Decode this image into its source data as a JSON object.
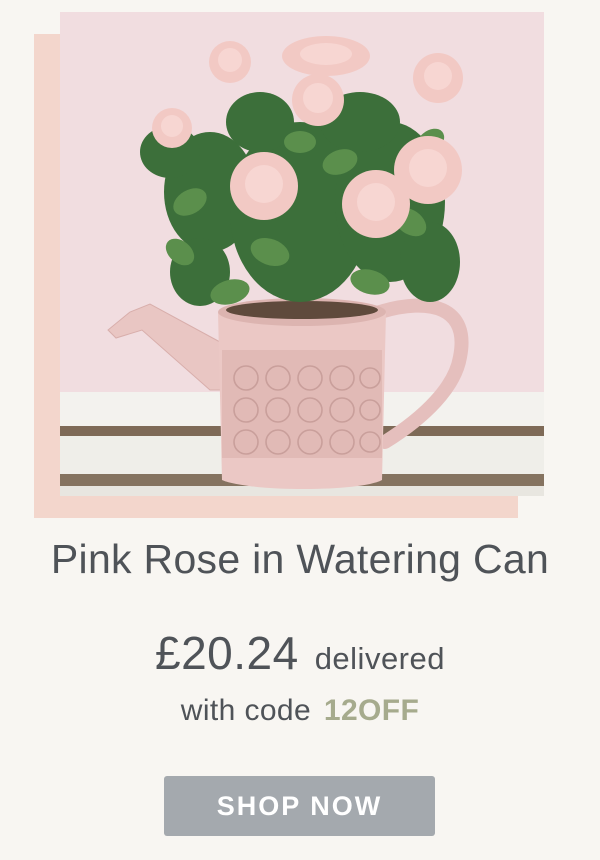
{
  "product": {
    "title": "Pink Rose in Watering Can",
    "price": "£20.24",
    "price_suffix": "delivered",
    "code_prefix": "with code",
    "code": "12OFF"
  },
  "cta": {
    "label": "SHOP NOW"
  },
  "colors": {
    "background": "#f8f6f2",
    "backing_panel": "#f3d6cc",
    "text": "#4f5358",
    "code_accent": "#a6ab8d",
    "button": "#a4a9ae"
  }
}
